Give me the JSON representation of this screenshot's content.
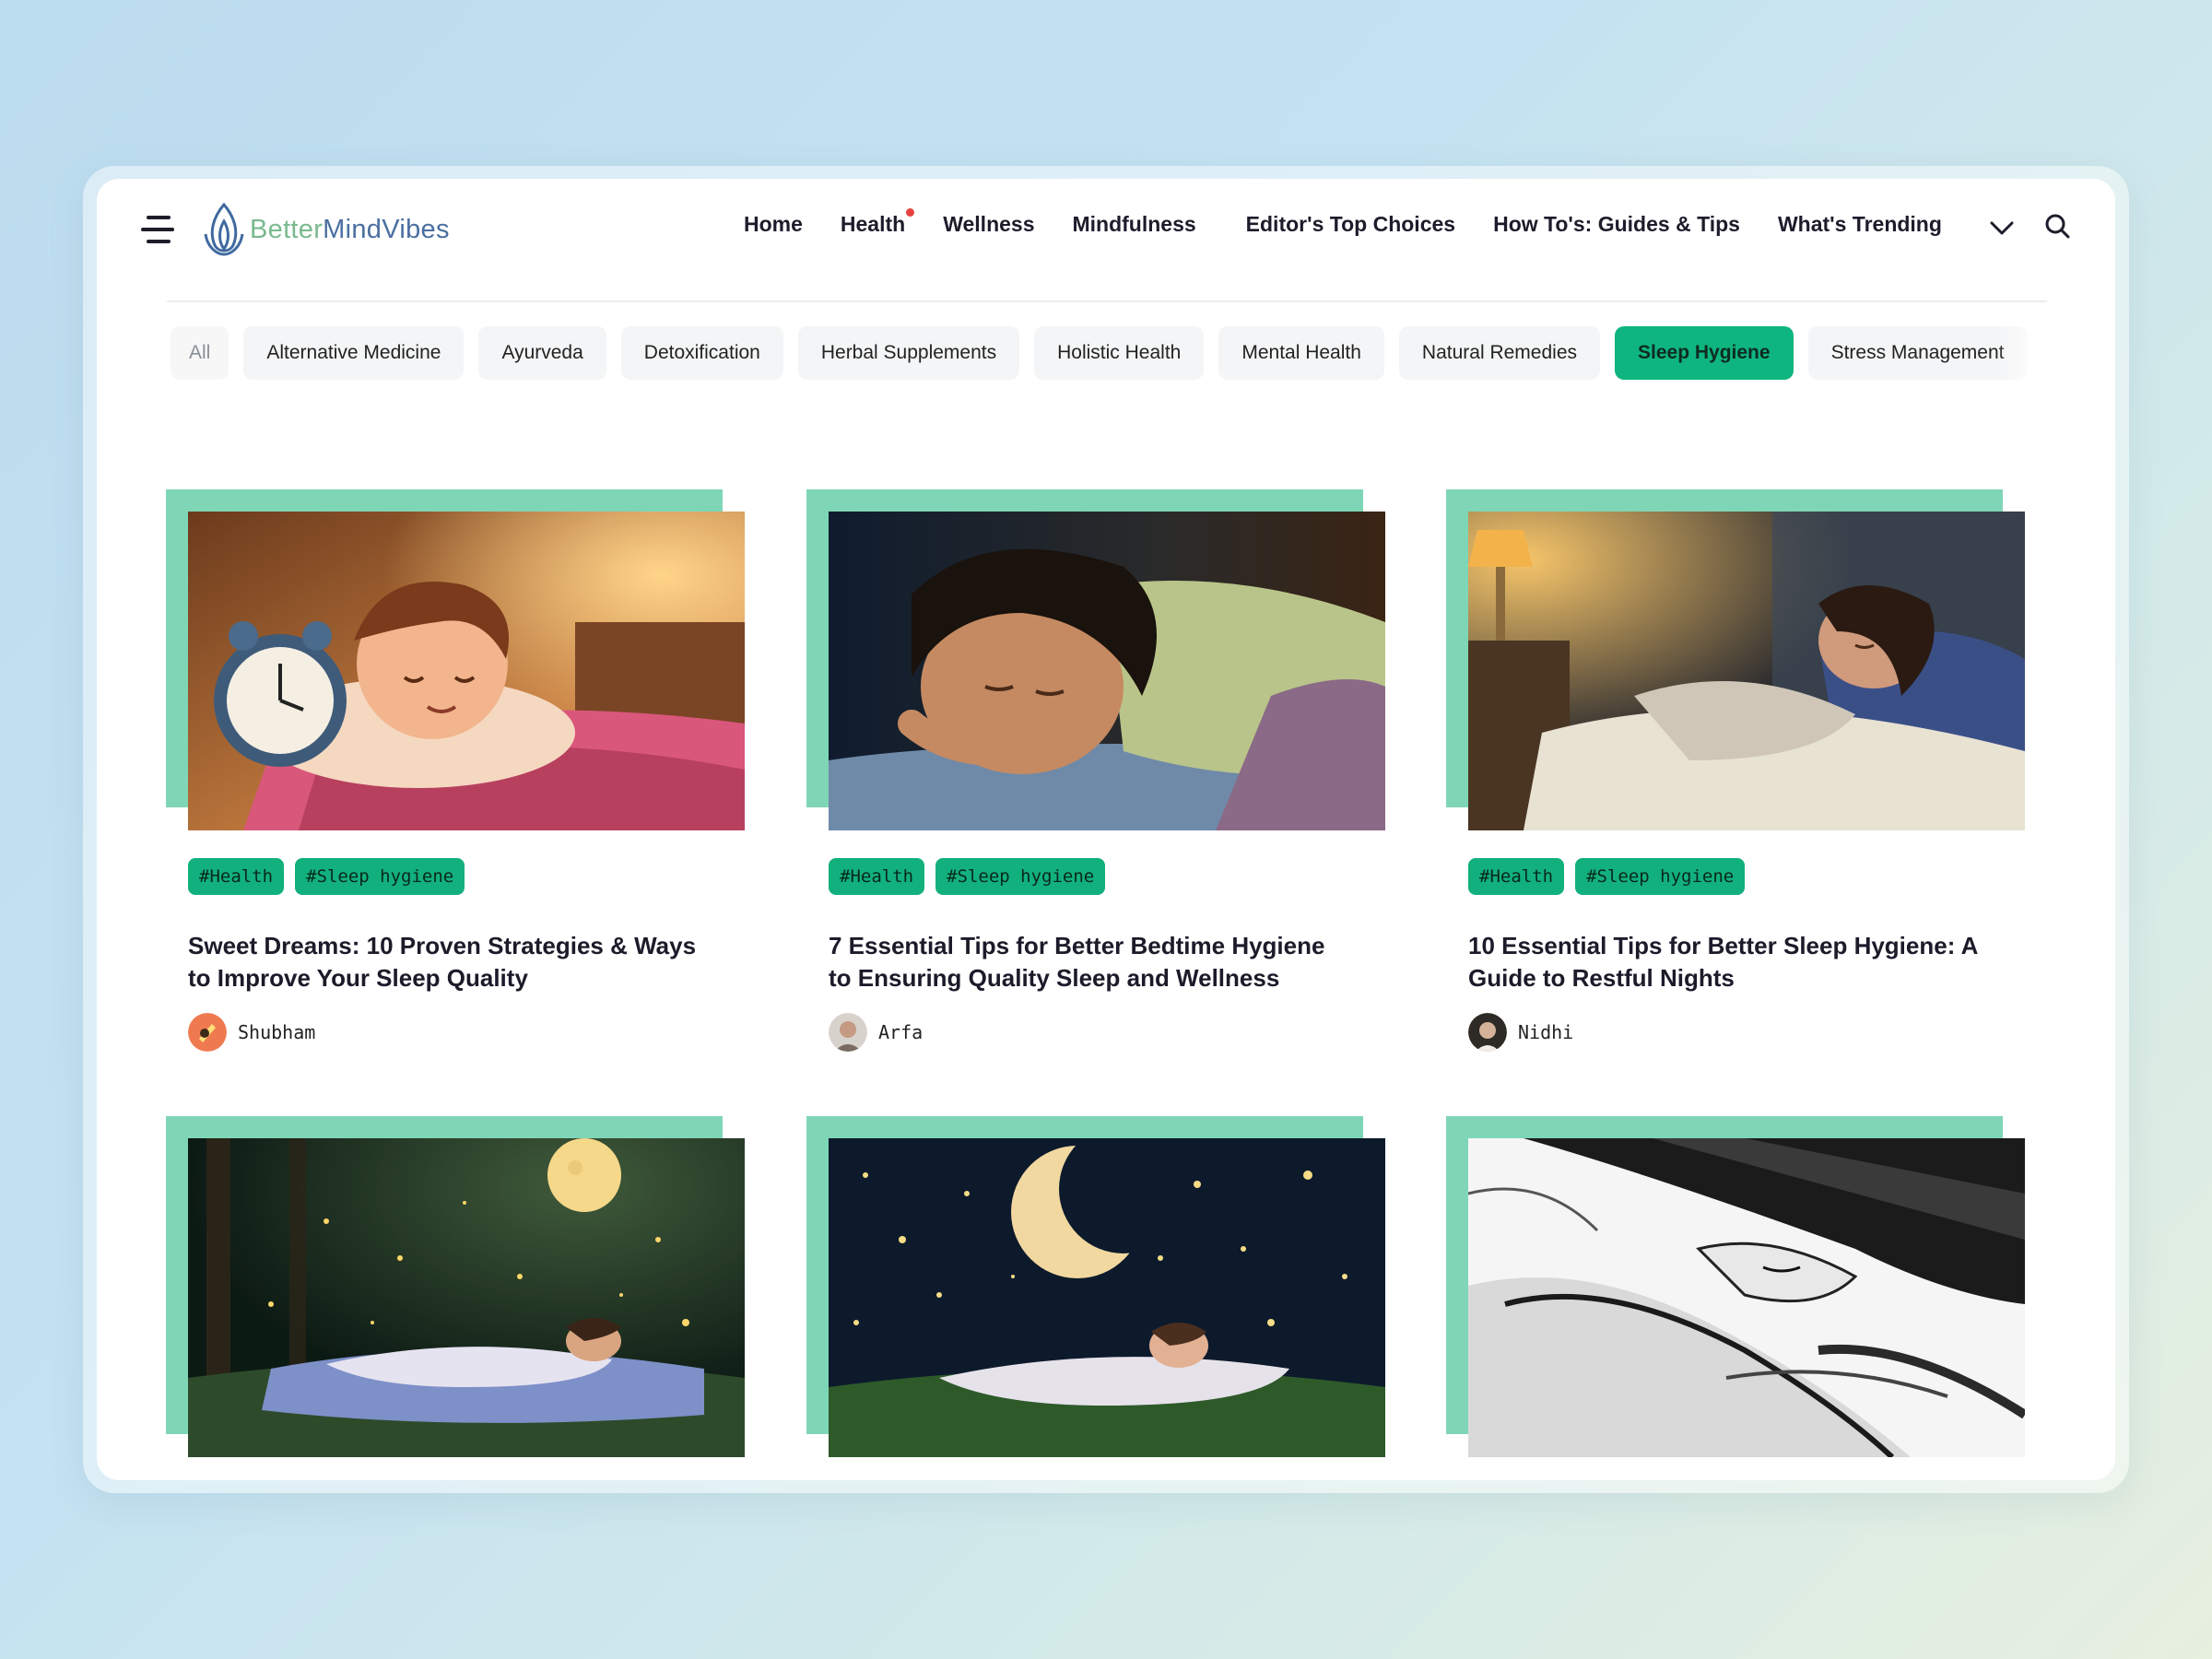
{
  "brand": {
    "part1": "Better",
    "part2": "MindVibes"
  },
  "nav": [
    {
      "label": "Home"
    },
    {
      "label": "Health"
    },
    {
      "label": "Wellness"
    },
    {
      "label": "Mindfulness"
    },
    {
      "label": "Editor's Top Choices"
    },
    {
      "label": "How To's: Guides & Tips"
    },
    {
      "label": "What's Trending"
    }
  ],
  "categories": [
    "All",
    "Alternative Medicine",
    "Ayurveda",
    "Detoxification",
    "Herbal Supplements",
    "Holistic Health",
    "Mental Health",
    "Natural Remedies",
    "Sleep Hygiene",
    "Stress Management"
  ],
  "active_category": "Sleep Hygiene",
  "colors": {
    "accent": "#0fb57f",
    "card_accent": "#7fd6b6",
    "notification_dot": "#e8423f"
  },
  "articles": [
    {
      "tags": [
        "#Health",
        "#Sleep hygiene"
      ],
      "title": "Sweet Dreams: 10 Proven Strategies & Ways to Improve Your Sleep Quality",
      "author": "Shubham"
    },
    {
      "tags": [
        "#Health",
        "#Sleep hygiene"
      ],
      "title": "7 Essential Tips for Better Bedtime Hygiene to Ensuring Quality Sleep and Wellness",
      "author": "Arfa"
    },
    {
      "tags": [
        "#Health",
        "#Sleep hygiene"
      ],
      "title": "10 Essential Tips for Better Sleep Hygiene: A Guide to Restful Nights",
      "author": "Nidhi"
    },
    {
      "tags": [],
      "title": "",
      "author": ""
    },
    {
      "tags": [],
      "title": "",
      "author": ""
    },
    {
      "tags": [],
      "title": "",
      "author": ""
    }
  ]
}
